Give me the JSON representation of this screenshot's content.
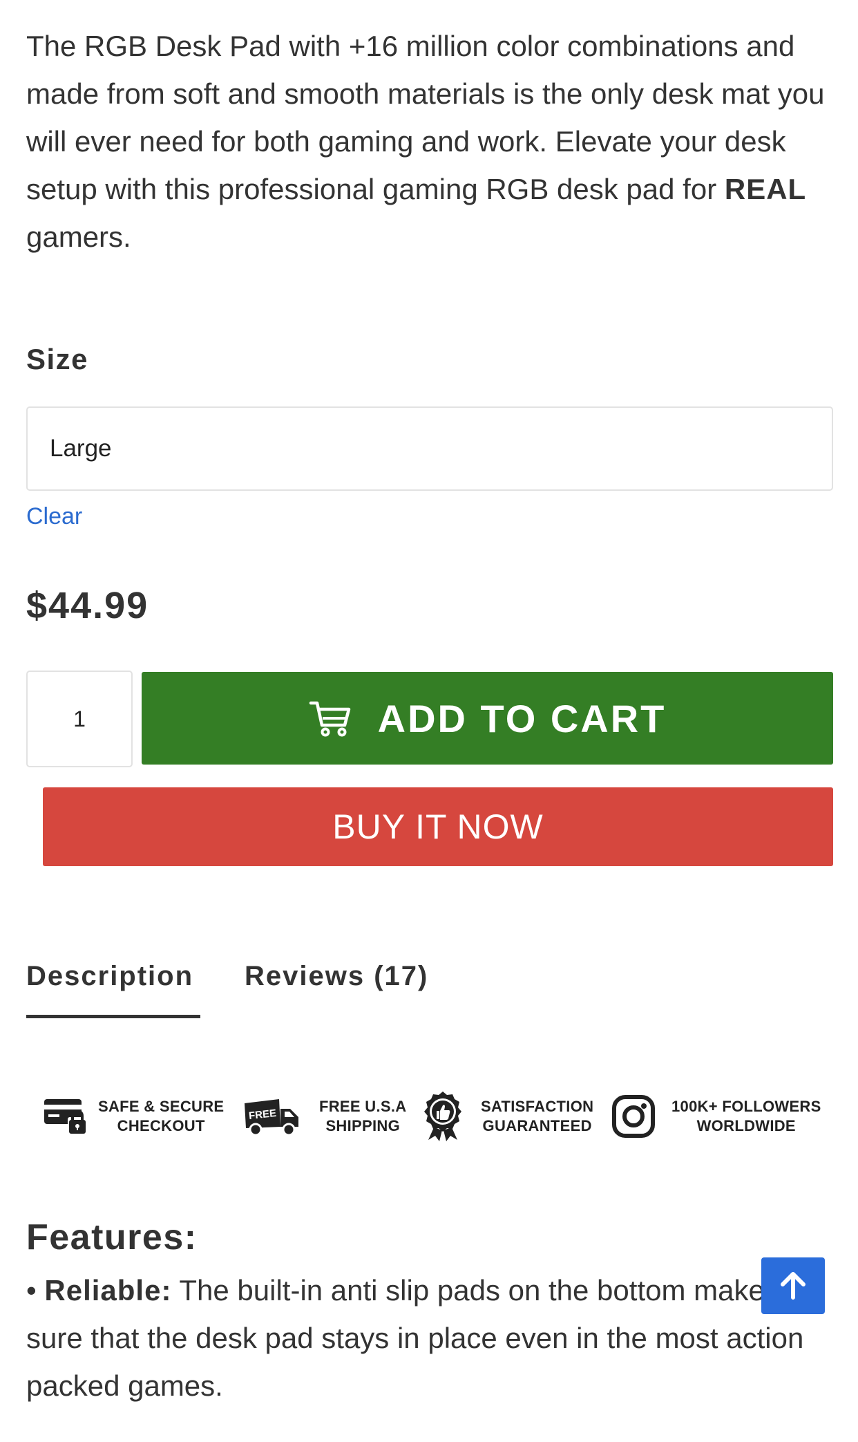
{
  "intro": {
    "text_before": "The RGB Desk Pad with +16 million color combinations and made from soft and smooth materials is the only desk mat you will ever need for both gaming and work. Elevate your desk setup with this professional gaming RGB desk pad for ",
    "emphasis": "REAL",
    "text_after": " gamers."
  },
  "variation": {
    "label": "Size",
    "selected": "Large",
    "clear_label": "Clear"
  },
  "price": "$44.99",
  "cart": {
    "quantity": "1",
    "add_label": "ADD TO CART",
    "buy_label": "BUY IT NOW"
  },
  "tabs": {
    "description": "Description",
    "reviews": "Reviews (17)",
    "active": "description"
  },
  "badges": [
    {
      "line1": "SAFE & SECURE",
      "line2": "CHECKOUT",
      "icon": "secure-card-icon"
    },
    {
      "line1": "FREE U.S.A",
      "line2": "SHIPPING",
      "icon": "free-shipping-truck-icon",
      "icon_text": "FREE"
    },
    {
      "line1": "SATISFACTION",
      "line2": "GUARANTEED",
      "icon": "thumbs-up-badge-icon"
    },
    {
      "line1": "100K+ FOLLOWERS",
      "line2": "WORLDWIDE",
      "icon": "instagram-icon"
    }
  ],
  "features": {
    "title": "Features:",
    "bullet": "•",
    "item_title": "Reliable:",
    "item_text": " The built-in anti slip pads on the bottom makes sure that the desk pad stays in place even in the most action packed games."
  },
  "colors": {
    "add_to_cart": "#347e25",
    "buy_now": "#d6473e",
    "link": "#2b6bcf",
    "scroll_top": "#2b6ddb"
  }
}
